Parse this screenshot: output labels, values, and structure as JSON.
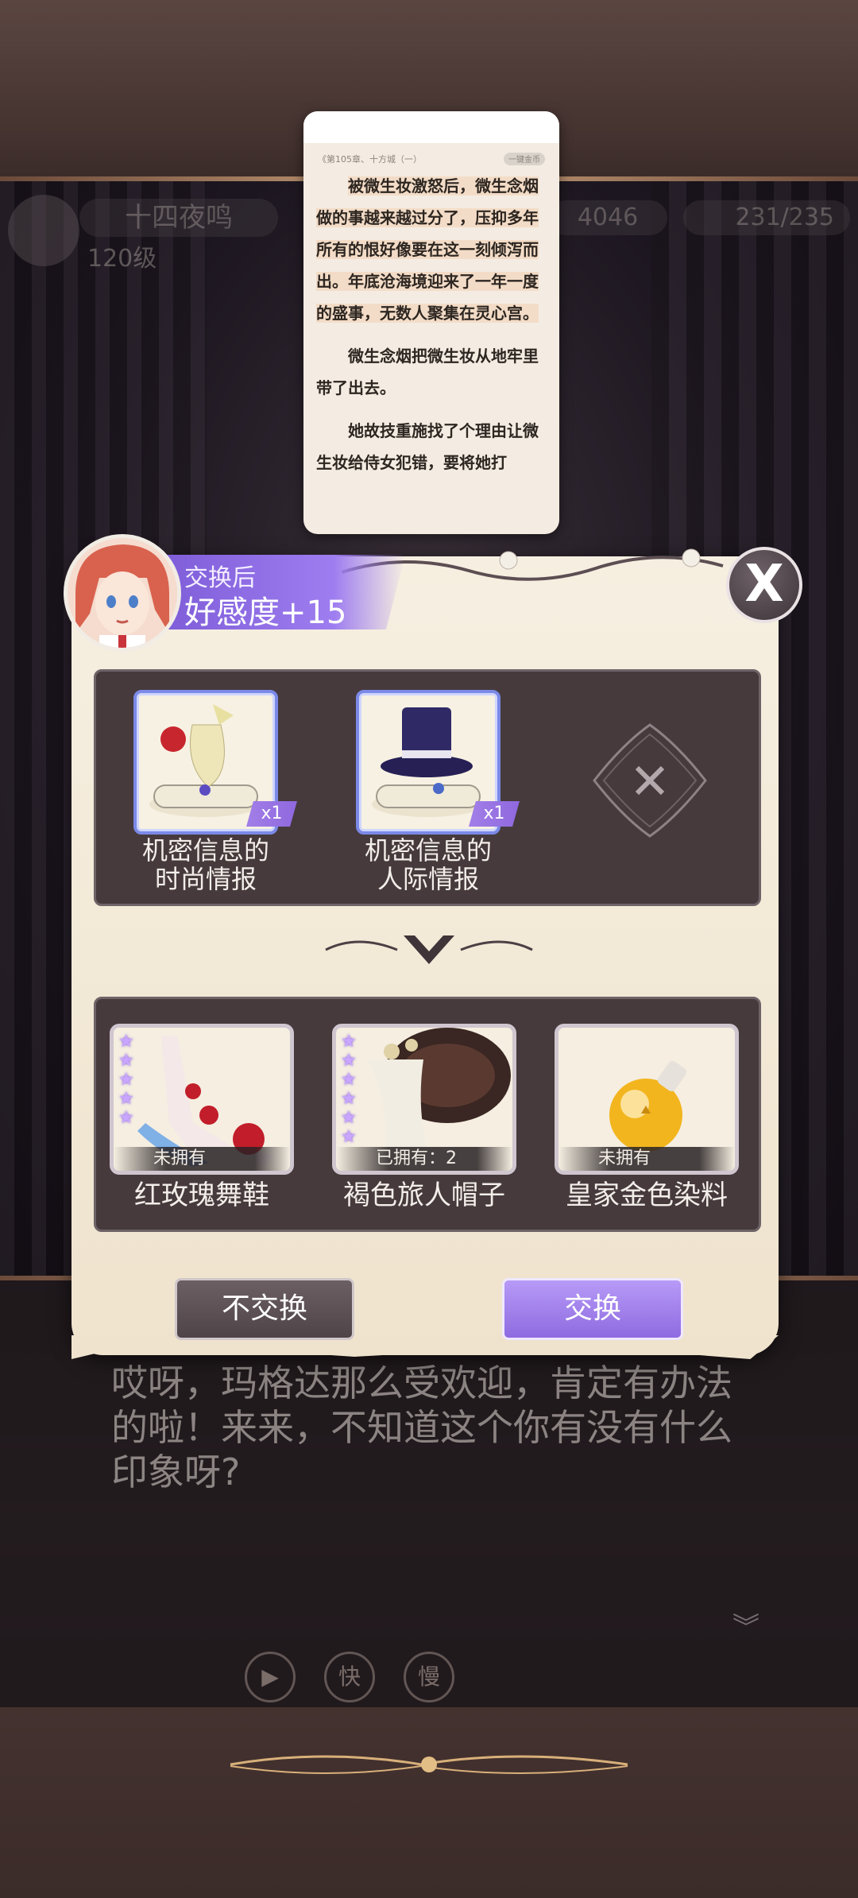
{
  "hud": {
    "name": "十四夜鸣",
    "level": "120级",
    "gold": "4046",
    "stamina": "231/235"
  },
  "book": {
    "chapter": "《第105章、十方城（一）",
    "tag": "一键金币",
    "paragraphs": [
      "被微生妆激怒后，微生念烟做的事越来越过分了，压抑多年所有的恨好像要在这一刻倾泻而出。年底沧海境迎来了一年一度的盛事，无数人聚集在灵心宫。",
      "微生念烟把微生妆从地牢里带了出去。",
      "她故技重施找了个理由让微生妆给侍女犯错，要将她打"
    ]
  },
  "affection": {
    "label": "交换后",
    "value": "好感度+15"
  },
  "give_items": [
    {
      "name_line1": "机密信息的",
      "name_line2": "时尚情报",
      "qty": "x1",
      "icon": "scroll-flower-icon"
    },
    {
      "name_line1": "机密信息的",
      "name_line2": "人际情报",
      "qty": "x1",
      "icon": "scroll-tophat-icon"
    }
  ],
  "get_items": [
    {
      "name": "红玫瑰舞鞋",
      "ownership": "未拥有",
      "stars": "★★★★★",
      "icon": "rose-heel-icon"
    },
    {
      "name": "褐色旅人帽子",
      "ownership": "已拥有：2",
      "stars": "★★★★★★",
      "icon": "brown-hat-icon"
    },
    {
      "name": "皇家金色染料",
      "ownership": "未拥有",
      "stars": "",
      "icon": "gold-dye-bottle-icon"
    }
  ],
  "buttons": {
    "decline": "不交换",
    "accept": "交换",
    "close": "X"
  },
  "dialog": {
    "text": "哎呀，玛格达那么受欢迎，肯定有办法的啦！来来，不知道这个你有没有什么印象呀?"
  },
  "controls": {
    "auto": "▶",
    "fast": "快",
    "slow": "慢"
  },
  "colors": {
    "accent": "#9b7bef",
    "panel": "#f3ead9",
    "slot": "#463a3d"
  }
}
